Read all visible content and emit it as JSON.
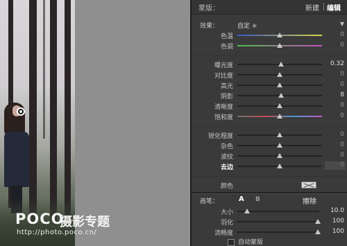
{
  "watermark": {
    "logo": "POCO",
    "subtitle": "摄影专题",
    "url": "http://photo.poco.cn/"
  },
  "panel": {
    "title": "蒙版：",
    "new_label": "新建",
    "edit_label": "编辑",
    "effect_label": "效果：",
    "effect_value": "自定 ≑",
    "collapse_glyph": "▼",
    "groups": [
      [
        {
          "name": "色温",
          "value": "0",
          "pos": 0.5,
          "track": "linear-gradient(90deg,#3c58c4,#d7d24a)"
        },
        {
          "name": "色调",
          "value": "0",
          "pos": 0.5,
          "track": "linear-gradient(90deg,#4dbf47,#c84fc4)"
        }
      ],
      [
        {
          "name": "曝光度",
          "value": "0.32",
          "pos": 0.52
        },
        {
          "name": "对比度",
          "value": "0",
          "pos": 0.5
        },
        {
          "name": "高光",
          "value": "0",
          "pos": 0.5
        },
        {
          "name": "阴影",
          "value": "8",
          "pos": 0.52
        },
        {
          "name": "清晰度",
          "value": "0",
          "pos": 0.5
        },
        {
          "name": "饱和度",
          "value": "0",
          "pos": 0.5,
          "track": "linear-gradient(90deg,#707070,#c44a4a,#4a9ad6,#c65ac4)"
        }
      ],
      [
        {
          "name": "锐化程度",
          "value": "0",
          "pos": 0.5
        },
        {
          "name": "杂色",
          "value": "0",
          "pos": 0.5
        },
        {
          "name": "波纹",
          "value": "0",
          "pos": 0.5
        },
        {
          "name": "去边",
          "value": "0",
          "pos": 0.5,
          "bold": true,
          "boxed": true
        }
      ]
    ],
    "color_label": "颜色",
    "brush": {
      "label": "画笔：",
      "tab_a": "A",
      "tab_b": "B",
      "erase": "擦除",
      "rows": [
        {
          "name": "大小",
          "value": "10.0",
          "pos": 0.12
        },
        {
          "name": "羽化",
          "value": "100",
          "pos": 0.98
        },
        {
          "name": "流畅度",
          "value": "100",
          "pos": 0.98
        }
      ],
      "automask_label": "自动蒙版"
    }
  }
}
